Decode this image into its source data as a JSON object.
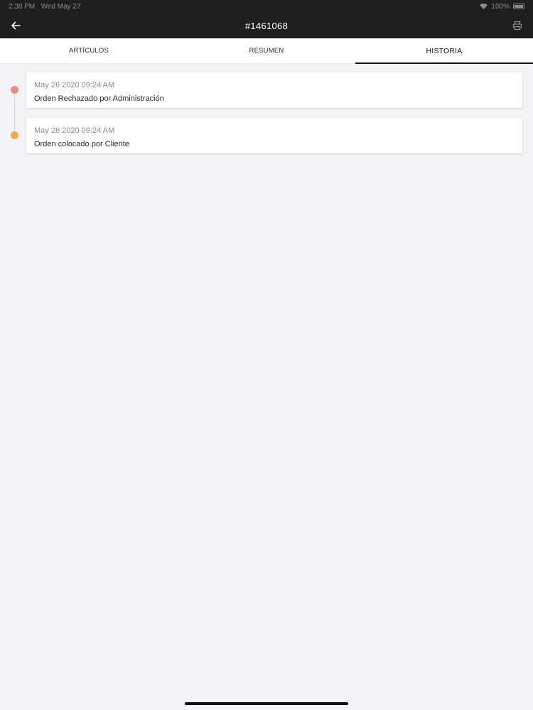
{
  "statusbar": {
    "time": "2:38 PM",
    "date": "Wed May 27",
    "battery": "100%"
  },
  "header": {
    "title": "#1461068"
  },
  "icons": {
    "back": "arrow-left-icon",
    "print": "printer-icon"
  },
  "tabs": [
    {
      "label": "ARTÍCULOS",
      "active": false
    },
    {
      "label": "RESUMEN",
      "active": false
    },
    {
      "label": "HISTORIA",
      "active": true
    }
  ],
  "history": [
    {
      "date": "May 26 2020 09:24 AM",
      "description": "Orden Rechazado por Administración",
      "status_color": "#f28b82"
    },
    {
      "date": "May 26 2020 09:24 AM",
      "description": "Orden colocado por Cliente",
      "status_color": "#f5a94a"
    }
  ],
  "colors": {
    "header_bg": "#1e1e1e",
    "page_bg": "#f4f3f6",
    "rejected": "#f28b82",
    "placed": "#f5a94a"
  }
}
